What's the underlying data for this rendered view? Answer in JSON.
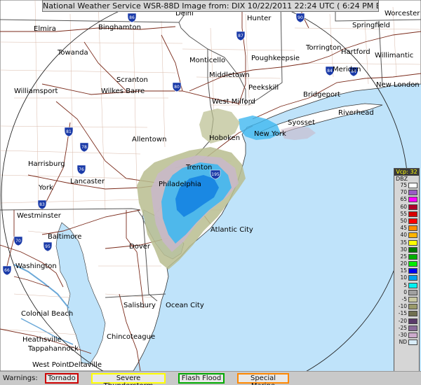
{
  "title": "National Weather Service WSR-88D Image from: DIX 10/22/2011 22:24 UTC ( 6:24 PM EDT)",
  "colors": {
    "ocean": "#bfe3fa",
    "land": "#ffffff",
    "county_lines": "#d0b0a0",
    "state_lines": "#555555",
    "roads": "#7a2a1a",
    "range_ring": "#222222"
  },
  "cities": [
    {
      "name": "Elmira"
    },
    {
      "name": "Binghamton"
    },
    {
      "name": "Delhi"
    },
    {
      "name": "Hunter"
    },
    {
      "name": "Worcester"
    },
    {
      "name": "Springfield"
    },
    {
      "name": "Towanda"
    },
    {
      "name": "Monticello"
    },
    {
      "name": "Poughkeepsie"
    },
    {
      "name": "Torrington"
    },
    {
      "name": "Hartford"
    },
    {
      "name": "Willimantic"
    },
    {
      "name": "Middletown"
    },
    {
      "name": "Meriden"
    },
    {
      "name": "Scranton"
    },
    {
      "name": "Wilkes Barre"
    },
    {
      "name": "Williamsport"
    },
    {
      "name": "Peekskill"
    },
    {
      "name": "New London"
    },
    {
      "name": "Bridgeport"
    },
    {
      "name": "West Milford"
    },
    {
      "name": "Riverhead"
    },
    {
      "name": "Syosset"
    },
    {
      "name": "New York"
    },
    {
      "name": "Hoboken"
    },
    {
      "name": "Allentown"
    },
    {
      "name": "Harrisburg"
    },
    {
      "name": "Trenton"
    },
    {
      "name": "Lancaster"
    },
    {
      "name": "Philadelphia"
    },
    {
      "name": "York"
    },
    {
      "name": "Westminster"
    },
    {
      "name": "Atlantic City"
    },
    {
      "name": "Baltimore"
    },
    {
      "name": "Dover"
    },
    {
      "name": "Washington"
    },
    {
      "name": "Salisbury"
    },
    {
      "name": "Ocean City"
    },
    {
      "name": "Colonial Beach"
    },
    {
      "name": "Chincoteague"
    },
    {
      "name": "Heathsville"
    },
    {
      "name": "Tappahannock"
    },
    {
      "name": "West Point"
    },
    {
      "name": "Deltaville"
    }
  ],
  "interstates": [
    "86",
    "90",
    "87",
    "84",
    "80",
    "81",
    "78",
    "76",
    "83",
    "70",
    "95",
    "195",
    "66",
    "84"
  ],
  "legend": {
    "header": "Vcp: 32",
    "unit": "DBZ",
    "levels": [
      {
        "label": "75",
        "color": "#ffffff"
      },
      {
        "label": "70",
        "color": "#9a5cc4"
      },
      {
        "label": "65",
        "color": "#ff00ff"
      },
      {
        "label": "60",
        "color": "#b0002a"
      },
      {
        "label": "55",
        "color": "#d80000"
      },
      {
        "label": "50",
        "color": "#ff0000"
      },
      {
        "label": "45",
        "color": "#ff8c00"
      },
      {
        "label": "40",
        "color": "#ffb400"
      },
      {
        "label": "35",
        "color": "#ffff00"
      },
      {
        "label": "30",
        "color": "#007a00"
      },
      {
        "label": "25",
        "color": "#00b000"
      },
      {
        "label": "20",
        "color": "#00ee00"
      },
      {
        "label": "15",
        "color": "#0000f0"
      },
      {
        "label": "10",
        "color": "#00a0f0"
      },
      {
        "label": "5",
        "color": "#00f0f0"
      },
      {
        "label": "0",
        "color": "#a0a0a0"
      },
      {
        "label": "-5",
        "color": "#c8c8a0"
      },
      {
        "label": "-10",
        "color": "#9a9a6a"
      },
      {
        "label": "-15",
        "color": "#707050"
      },
      {
        "label": "-20",
        "color": "#5a3a6a"
      },
      {
        "label": "-25",
        "color": "#8a6a9a"
      },
      {
        "label": "-30",
        "color": "#ccaacc"
      },
      {
        "label": "ND",
        "color": "#d8ecf8"
      }
    ]
  },
  "warnings": {
    "label": "Warnings:",
    "items": [
      {
        "name": "Tornado",
        "color": "#cc0000"
      },
      {
        "name": "Severe Thunderstorm",
        "color": "#ffff00"
      },
      {
        "name": "Flash Flood",
        "color": "#00aa00"
      },
      {
        "name": "Special Marine",
        "color": "#ff8800"
      }
    ]
  }
}
